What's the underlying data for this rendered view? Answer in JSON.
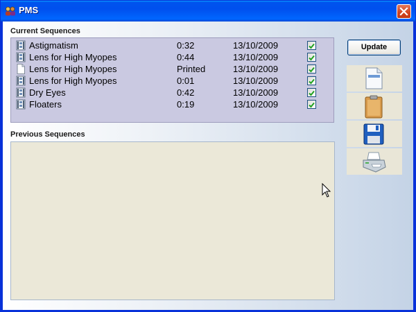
{
  "window": {
    "title": "PMS"
  },
  "icons": {
    "app": "pms-app-icon",
    "close": "close-icon",
    "row_film": "film-sequence-icon",
    "row_printed": "printed-document-icon",
    "new": "new-document-icon",
    "paste": "clipboard-icon",
    "save": "floppy-disk-icon",
    "print": "printer-icon",
    "cursor": "mouse-pointer-icon"
  },
  "current": {
    "label": "Current Sequences",
    "rows": [
      {
        "icon": "film",
        "name": "Astigmatism",
        "duration": "0:32",
        "date": "13/10/2009",
        "checked": true
      },
      {
        "icon": "film",
        "name": "Lens for High Myopes",
        "duration": "0:44",
        "date": "13/10/2009",
        "checked": true
      },
      {
        "icon": "printed",
        "name": "Lens for High Myopes",
        "duration": "Printed",
        "date": "13/10/2009",
        "checked": true
      },
      {
        "icon": "film",
        "name": "Lens for High Myopes",
        "duration": "0:01",
        "date": "13/10/2009",
        "checked": true
      },
      {
        "icon": "film",
        "name": "Dry Eyes",
        "duration": "0:42",
        "date": "13/10/2009",
        "checked": true
      },
      {
        "icon": "film",
        "name": "Floaters",
        "duration": "0:19",
        "date": "13/10/2009",
        "checked": true
      }
    ]
  },
  "previous": {
    "label": "Previous Sequences",
    "rows": []
  },
  "toolbar": {
    "update_label": "Update"
  },
  "colors": {
    "title_bar": "#0050ee",
    "current_panel_bg": "#cac9e1",
    "previous_panel_bg": "#ebe8d8",
    "check_green": "#21a121",
    "close_red": "#d2431e"
  }
}
